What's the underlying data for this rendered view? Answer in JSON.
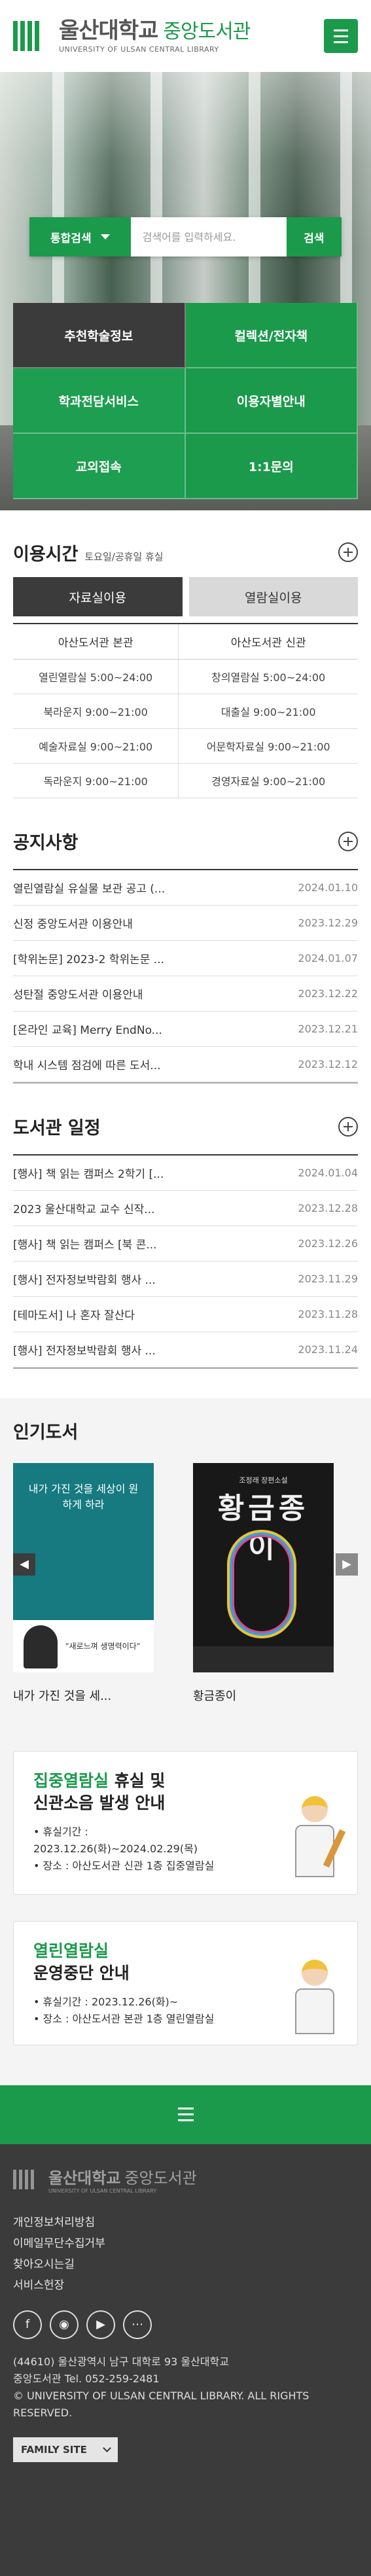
{
  "header": {
    "logo_ko": "울산대학교",
    "logo_ko_sub": "중앙도서관",
    "logo_en": "UNIVERSITY OF ULSAN CENTRAL LIBRARY"
  },
  "search": {
    "type_label": "통합검색",
    "placeholder": "검색어를 입력하세요.",
    "button_label": "검색"
  },
  "quick_links": [
    "추천학술정보",
    "컬렉션/전자책",
    "학과전담서비스",
    "이용자별안내",
    "교외접속",
    "1:1문의"
  ],
  "hours": {
    "title": "이용시간",
    "subtitle": "토요일/공휴일 휴실",
    "tabs": [
      "자료실이용",
      "열람실이용"
    ],
    "columns": [
      "아산도서관 본관",
      "아산도서관 신관"
    ],
    "rows": [
      [
        "열린열람실 5:00~24:00",
        "창의열람실 5:00~24:00"
      ],
      [
        "북라운지 9:00~21:00",
        "대출실 9:00~21:00"
      ],
      [
        "예술자료실 9:00~21:00",
        "어문학자료실 9:00~21:00"
      ],
      [
        "독라운지 9:00~21:00",
        "경영자료실 9:00~21:00"
      ]
    ]
  },
  "notices": {
    "title": "공지사항",
    "items": [
      {
        "title": "열린열람실 유실물 보관 공고 (...",
        "date": "2024.01.10"
      },
      {
        "title": "신정 중앙도서관 이용안내",
        "date": "2023.12.29"
      },
      {
        "title": "[학위논문] 2023-2 학위논문 ...",
        "date": "2024.01.07"
      },
      {
        "title": "성탄절 중앙도서관 이용안내",
        "date": "2023.12.22"
      },
      {
        "title": "[온라인 교육] Merry EndNo...",
        "date": "2023.12.21"
      },
      {
        "title": "학내 시스템 점검에 따른 도서...",
        "date": "2023.12.12"
      }
    ]
  },
  "schedule": {
    "title": "도서관 일정",
    "items": [
      {
        "title": "[행사] 책 읽는 캠퍼스 2학기 [...",
        "date": "2024.01.04"
      },
      {
        "title": "2023 울산대학교 교수 신작...",
        "date": "2023.12.28"
      },
      {
        "title": "[행사] 책 읽는 캠퍼스 [북 콘...",
        "date": "2023.12.26"
      },
      {
        "title": "[행사] 전자정보박람회 행사 ...",
        "date": "2023.11.29"
      },
      {
        "title": "[테마도서] 나 혼자 잘산다",
        "date": "2023.11.28"
      },
      {
        "title": "[행사] 전자정보박람회 행사 ...",
        "date": "2023.11.24"
      }
    ]
  },
  "popular": {
    "title": "인기도서",
    "books": [
      {
        "title": "내가 가진 것을 세...",
        "cover_title": "내가 가진 것을 세상이 원하게 하라",
        "cover_quote": "\"새로느껴 생명력이다\""
      },
      {
        "title": "황금종이",
        "cover_author": "조정래 장편소설",
        "cover_title": "황금종이"
      }
    ]
  },
  "notice_cards": [
    {
      "title_green": "집중열람실",
      "title_rest": " 휴실 및",
      "title_line2": "신관소음 발생 안내",
      "items": [
        "• 휴실기간 :",
        "2023.12.26(화)~2024.02.29(목)",
        "• 장소 : 아산도서관 신관 1층 집중열람실"
      ]
    },
    {
      "title_green": "열린열람실",
      "title_rest": "",
      "title_line2": "운영중단 안내",
      "items": [
        "• 휴실기간 : 2023.12.26(화)~",
        "• 장소 : 아산도서관 본관 1층 열린열람실"
      ]
    }
  ],
  "footer": {
    "logo_ko": "울산대학교",
    "logo_ko_sub": "중앙도서관",
    "logo_en": "UNIVERSITY OF ULSAN CENTRAL LIBRARY",
    "links": [
      "개인정보처리방침",
      "이메일무단수집거부",
      "찾아오시는길",
      "서비스헌장"
    ],
    "address_1": "(44610) 울산광역시 남구 대학로 93 울산대학교",
    "address_2": "중앙도서관 Tel. 052-259-2481",
    "copyright": "© UNIVERSITY OF ULSAN CENTRAL LIBRARY. ALL RIGHTS RESERVED.",
    "family_site": "FAMILY SITE"
  },
  "colors": {
    "brand_green": "#1b9a4b",
    "dark": "#3b3b3b"
  }
}
